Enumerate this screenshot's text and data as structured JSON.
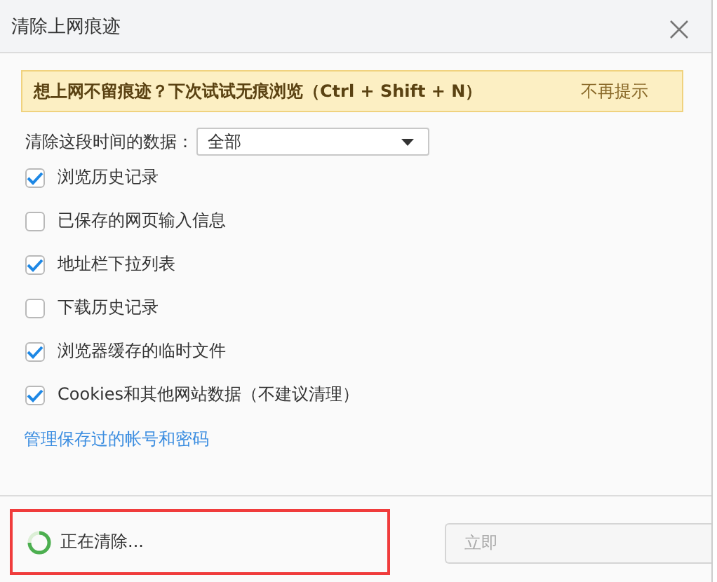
{
  "window": {
    "title": "清除上网痕迹"
  },
  "banner": {
    "message": "想上网不留痕迹？下次试试无痕浏览（Ctrl + Shift + N）",
    "dismiss": "不再提示"
  },
  "time_range": {
    "label": "清除这段时间的数据：",
    "value": "全部"
  },
  "options": [
    {
      "label": "浏览历史记录",
      "checked": true
    },
    {
      "label": "已保存的网页输入信息",
      "checked": false
    },
    {
      "label": "地址栏下拉列表",
      "checked": true
    },
    {
      "label": "下载历史记录",
      "checked": false
    },
    {
      "label": "浏览器缓存的临时文件",
      "checked": true
    },
    {
      "label": "Cookies和其他网站数据（不建议清理）",
      "checked": true
    }
  ],
  "manage_link": "管理保存过的帐号和密码",
  "status": {
    "text": "正在清除...",
    "highlighted": true
  },
  "button": {
    "label": "立即",
    "disabled": true
  }
}
